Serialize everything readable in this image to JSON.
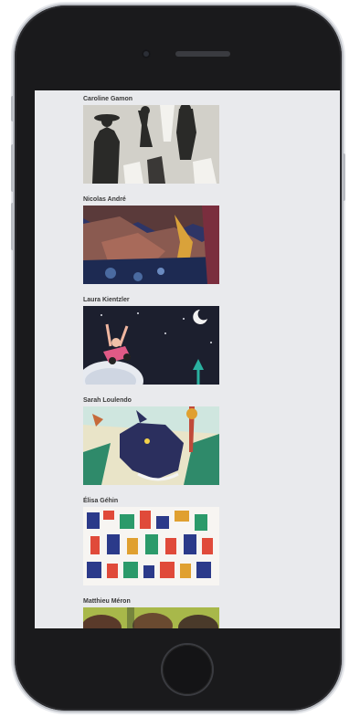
{
  "device": {
    "model": "iPhone"
  },
  "gallery": {
    "items": [
      {
        "artist": "Caroline Gamon"
      },
      {
        "artist": "Nicolas André"
      },
      {
        "artist": "Laura Kientzler"
      },
      {
        "artist": "Sarah Loulendo"
      },
      {
        "artist": "Élisa Géhin"
      },
      {
        "artist": "Matthieu Méron"
      }
    ]
  },
  "icons": {
    "home": "home-button-icon",
    "camera": "front-camera-icon",
    "speaker": "earpiece-speaker-icon"
  },
  "colors": {
    "screen_bg": "#e9eaed",
    "phone_body": "#1a1a1c",
    "frame": "#b9bcc2"
  }
}
